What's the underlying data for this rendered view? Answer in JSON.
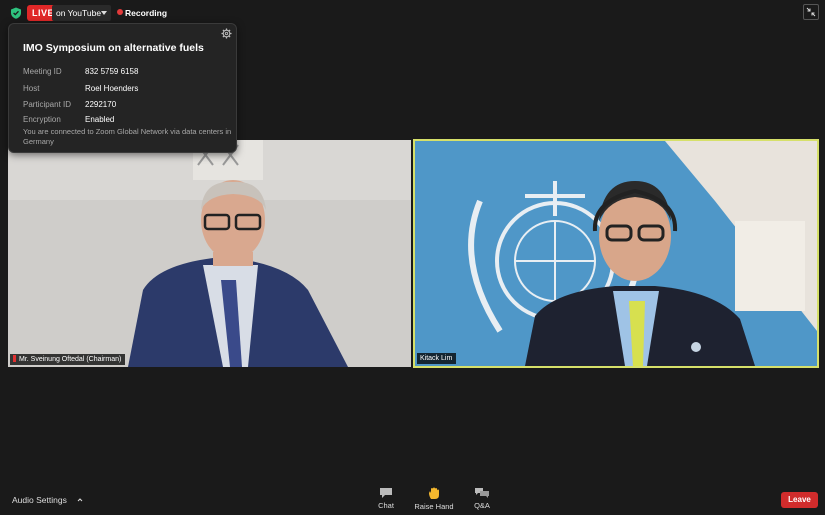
{
  "topbar": {
    "live_label": "LIVE",
    "stream_target": "on YouTube",
    "recording_label": "Recording"
  },
  "meeting_info": {
    "title": "IMO Symposium on alternative fuels",
    "rows": [
      {
        "label": "Meeting ID",
        "value": "832 5759 6158"
      },
      {
        "label": "Host",
        "value": "Roel Hoenders"
      },
      {
        "label": "Participant ID",
        "value": "2292170"
      },
      {
        "label": "Encryption",
        "value": "Enabled"
      }
    ],
    "note": "You are connected to Zoom Global Network via data centers in Germany"
  },
  "participants": [
    {
      "name": "Mr. Sveinung Oftedal (Chairman)",
      "muted": true
    },
    {
      "name": "Kitack Lim",
      "muted": false,
      "active_speaker": true
    }
  ],
  "toolbar": {
    "audio_settings_label": "Audio Settings",
    "chat_label": "Chat",
    "raise_hand_label": "Raise Hand",
    "qa_label": "Q&A",
    "leave_label": "Leave"
  },
  "colors": {
    "live_red": "#e02828",
    "active_speaker_border": "#d6e06a",
    "leave_red": "#d12c2c",
    "shield_green": "#2ec27e",
    "raise_hand_yellow": "#f5b82e"
  },
  "icons": [
    "shield-icon",
    "dropdown-caret-icon",
    "recording-dot-icon",
    "collapse-icon",
    "gear-icon",
    "chat-icon",
    "raise-hand-icon",
    "qa-icon",
    "chevron-up-icon"
  ]
}
